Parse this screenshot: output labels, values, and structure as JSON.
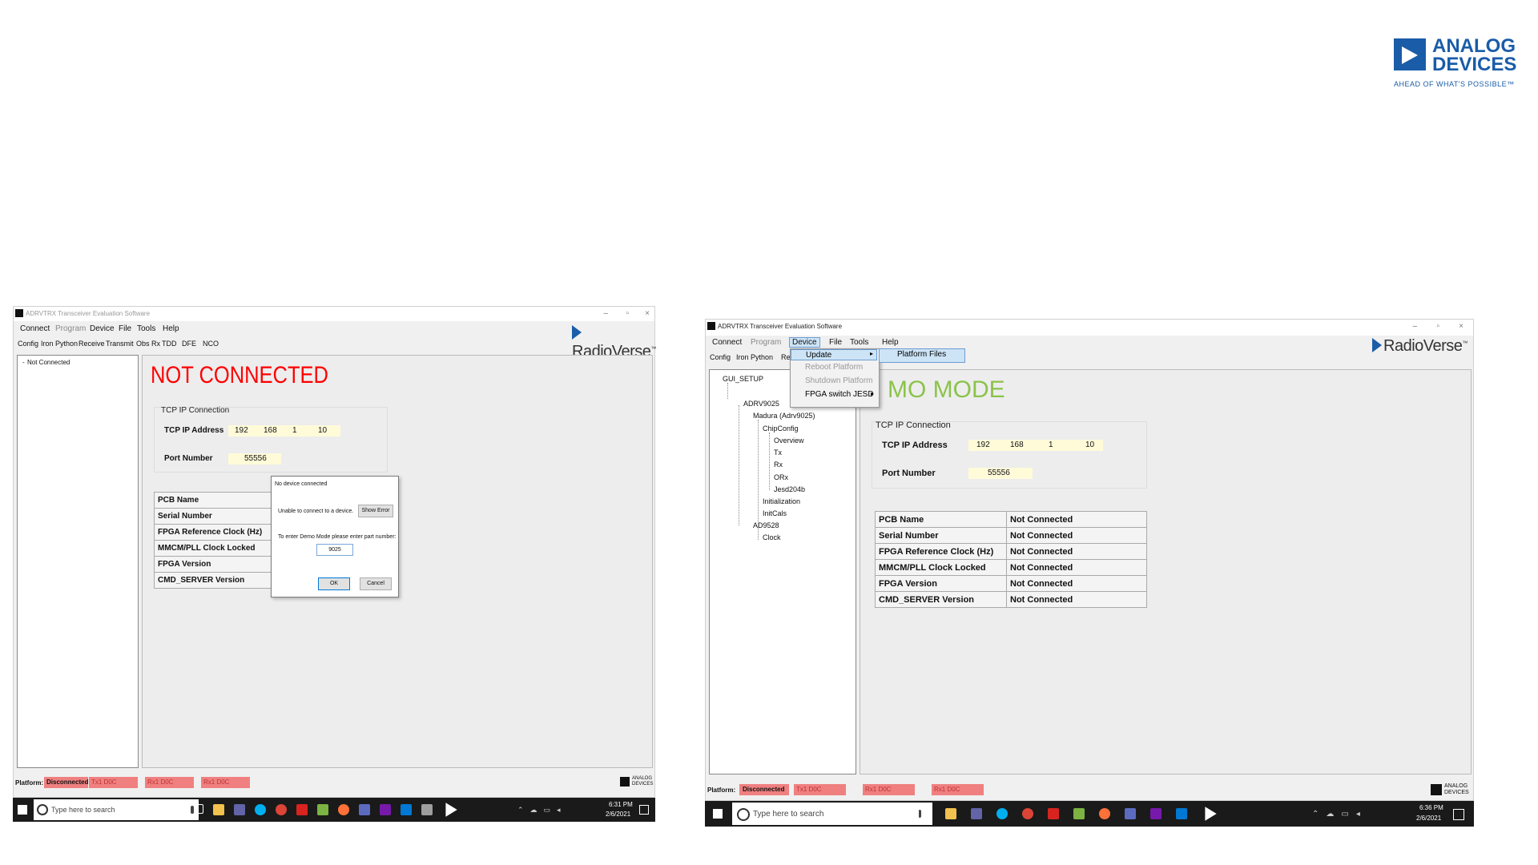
{
  "logo": {
    "brand_line1": "ANALOG",
    "brand_line2": "DEVICES",
    "tagline": "AHEAD OF WHAT'S POSSIBLE™"
  },
  "left": {
    "title": "ADRVTRX Transceiver Evaluation Software",
    "menu": [
      "Connect",
      "Program",
      "Device",
      "File",
      "Tools",
      "Help"
    ],
    "tabs": [
      "Config",
      "Iron Python",
      "Receive",
      "Transmit",
      "Obs Rx",
      "TDD",
      "DFE",
      "NCO"
    ],
    "tree_root": "Not Connected",
    "status_heading": "NOT CONNECTED",
    "status_color": "#ff0000",
    "tcp_group": "TCP IP Connection",
    "ip_label": "TCP IP Address",
    "ip": [
      "192",
      "168",
      "1",
      "10"
    ],
    "port_label": "Port Number",
    "port": "55556",
    "table_labels": [
      "PCB Name",
      "Serial Number",
      "FPGA Reference Clock (Hz)",
      "MMCM/PLL Clock Locked",
      "FPGA Version",
      "CMD_SERVER Version"
    ],
    "dialog": {
      "title": "No device connected",
      "message": "Unable to connect to a device.",
      "show_error": "Show Error",
      "prompt": "To enter Demo Mode please enter part number:",
      "value": "9025",
      "ok": "OK",
      "cancel": "Cancel"
    },
    "statusbar": {
      "platform_label": "Platform:",
      "platform_value": "Disconnected",
      "tx": "Tx1 D0C",
      "rx": "Rx1 D0C",
      "rx2": "Rx1 D0C"
    },
    "taskbar": {
      "search": "Type here to search",
      "time": "6:31 PM",
      "date": "2/6/2021"
    }
  },
  "right": {
    "title": "ADRVTRX Transceiver Evaluation Software",
    "menu": [
      "Connect",
      "Program",
      "Device",
      "File",
      "Tools",
      "Help"
    ],
    "tabs": [
      "Config",
      "Iron Python",
      "Re"
    ],
    "device_menu": [
      "Update",
      "Reboot Platform",
      "Shutdown Platform",
      "FPGA switch JESD"
    ],
    "submenu_item": "Platform Files",
    "tree": [
      "GUI_SETUP",
      "ADRV9025",
      "Madura (Adrv9025)",
      "ChipConfig",
      "Overview",
      "Tx",
      "Rx",
      "ORx",
      "Jesd204b",
      "Initialization",
      "InitCals",
      "AD9528",
      "Clock"
    ],
    "status_heading": "MO MODE",
    "status_color": "#8bc34a",
    "tcp_group": "TCP IP Connection",
    "ip_label": "TCP IP Address",
    "ip": [
      "192",
      "168",
      "1",
      "10"
    ],
    "port_label": "Port Number",
    "port": "55556",
    "table": [
      [
        "PCB Name",
        "Not Connected"
      ],
      [
        "Serial Number",
        "Not Connected"
      ],
      [
        "FPGA Reference Clock (Hz)",
        "Not Connected"
      ],
      [
        "MMCM/PLL Clock Locked",
        "Not Connected"
      ],
      [
        "FPGA Version",
        "Not Connected"
      ],
      [
        "CMD_SERVER Version",
        "Not Connected"
      ]
    ],
    "statusbar": {
      "platform_label": "Platform:",
      "platform_value": "Disconnected",
      "tx": "Tx1 D0C",
      "rx": "Rx1 D0C",
      "rx2": "Rx1 D0C"
    },
    "taskbar": {
      "search": "Type here to search",
      "time": "6:36 PM",
      "date": "2/6/2021"
    }
  },
  "radioverse": "RadioVerse",
  "corner_logo_text": "ANALOG DEVICES"
}
